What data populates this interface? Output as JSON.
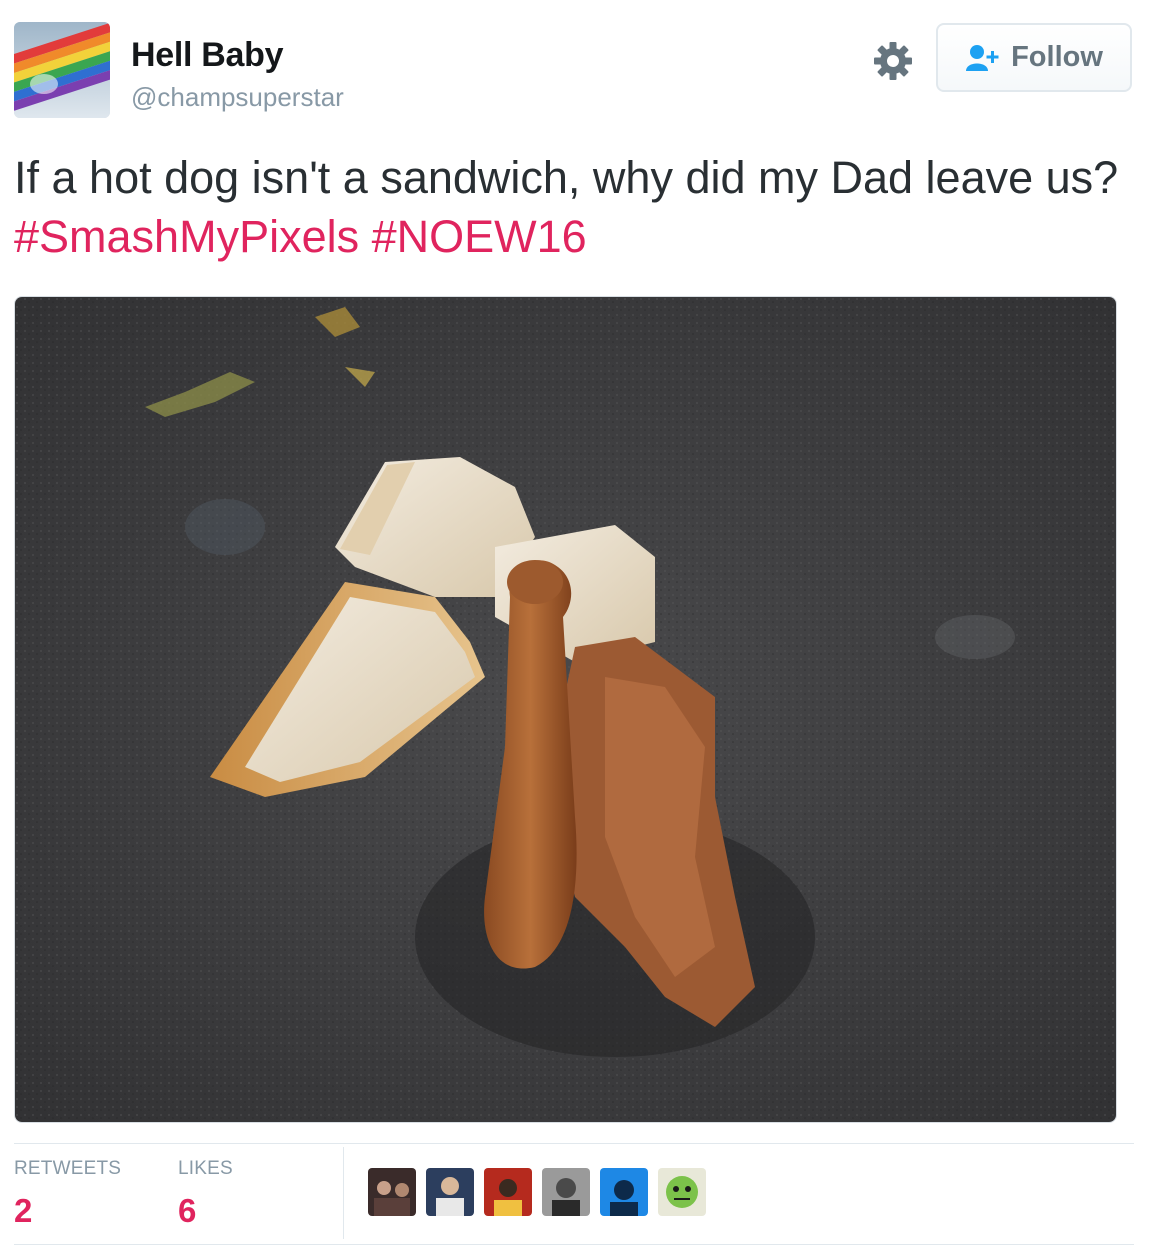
{
  "user": {
    "name": "Hell Baby",
    "handle": "@champsuperstar"
  },
  "follow_button": {
    "label": "Follow"
  },
  "tweet": {
    "text_plain": "If a hot dog isn't a sandwich, why did my Dad leave us?",
    "hashtags": [
      "#SmashMyPixels",
      "#NOEW16"
    ]
  },
  "stats": {
    "retweets_label": "RETWEETS",
    "retweets_value": "2",
    "likes_label": "LIKES",
    "likes_value": "6"
  },
  "colors": {
    "hashtag": "#e0245e",
    "muted": "#8899a6",
    "stat_value": "#e0245e"
  },
  "icons": {
    "settings": "gear-icon",
    "follow": "follow-person-plus-icon"
  }
}
